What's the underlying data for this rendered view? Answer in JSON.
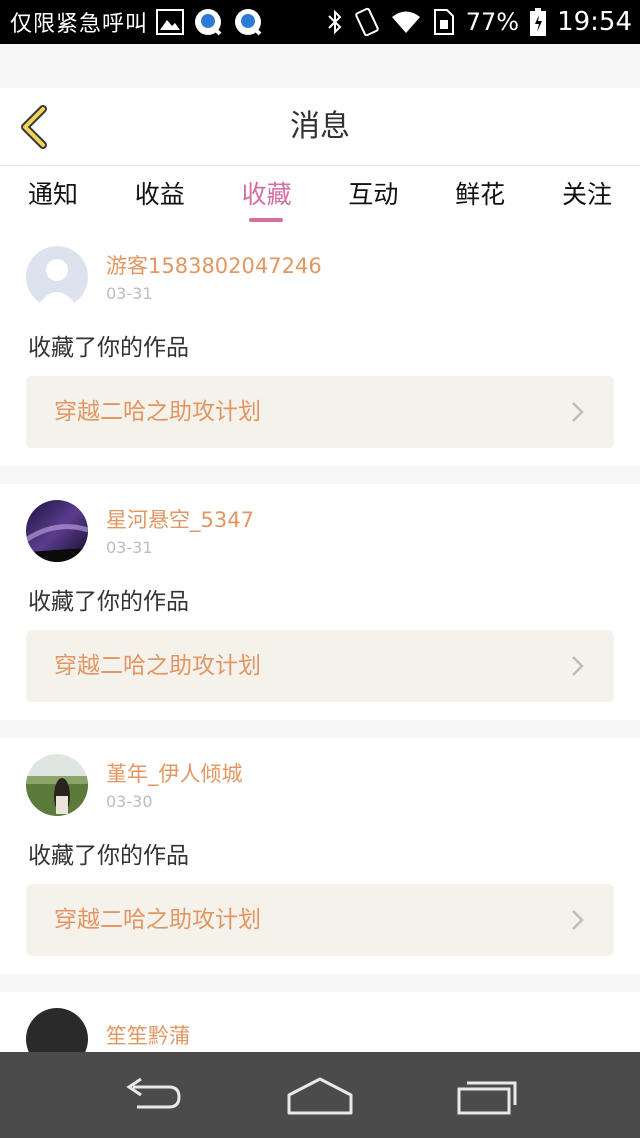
{
  "status_bar": {
    "notification_text": "仅限紧急呼叫",
    "icons_left": [
      "image-icon",
      "qq-icon",
      "qq-icon"
    ],
    "icons_right": [
      "bluetooth-icon",
      "vibrate-icon",
      "wifi-icon",
      "sim-icon"
    ],
    "battery_percent": "77%",
    "time": "19:54"
  },
  "header": {
    "back_icon": "chevron-left-icon",
    "title": "消息",
    "accent_color": "#e8c64a"
  },
  "tabs": [
    {
      "label": "通知",
      "active": false
    },
    {
      "label": "收益",
      "active": false
    },
    {
      "label": "收藏",
      "active": true
    },
    {
      "label": "互动",
      "active": false
    },
    {
      "label": "鲜花",
      "active": false
    },
    {
      "label": "关注",
      "active": false
    }
  ],
  "tab_active_color": "#d36fa2",
  "messages": [
    {
      "username": "游客1583802047246",
      "date": "03-31",
      "action": "收藏了你的作品",
      "work": "穿越二哈之助攻计划",
      "avatar": "default-avatar"
    },
    {
      "username": "星河悬空_5347",
      "date": "03-31",
      "action": "收藏了你的作品",
      "work": "穿越二哈之助攻计划",
      "avatar": "galaxy-avatar"
    },
    {
      "username": "堇年_伊人倾城",
      "date": "03-30",
      "action": "收藏了你的作品",
      "work": "穿越二哈之助攻计划",
      "avatar": "girl-field-avatar"
    }
  ],
  "partial_message": {
    "username": "笙笙黔蒲"
  },
  "colors": {
    "username": "#e29763",
    "work_box_bg": "#f5f2ec"
  },
  "nav_bar": {
    "buttons": [
      "back-icon",
      "home-icon",
      "recent-apps-icon"
    ]
  }
}
